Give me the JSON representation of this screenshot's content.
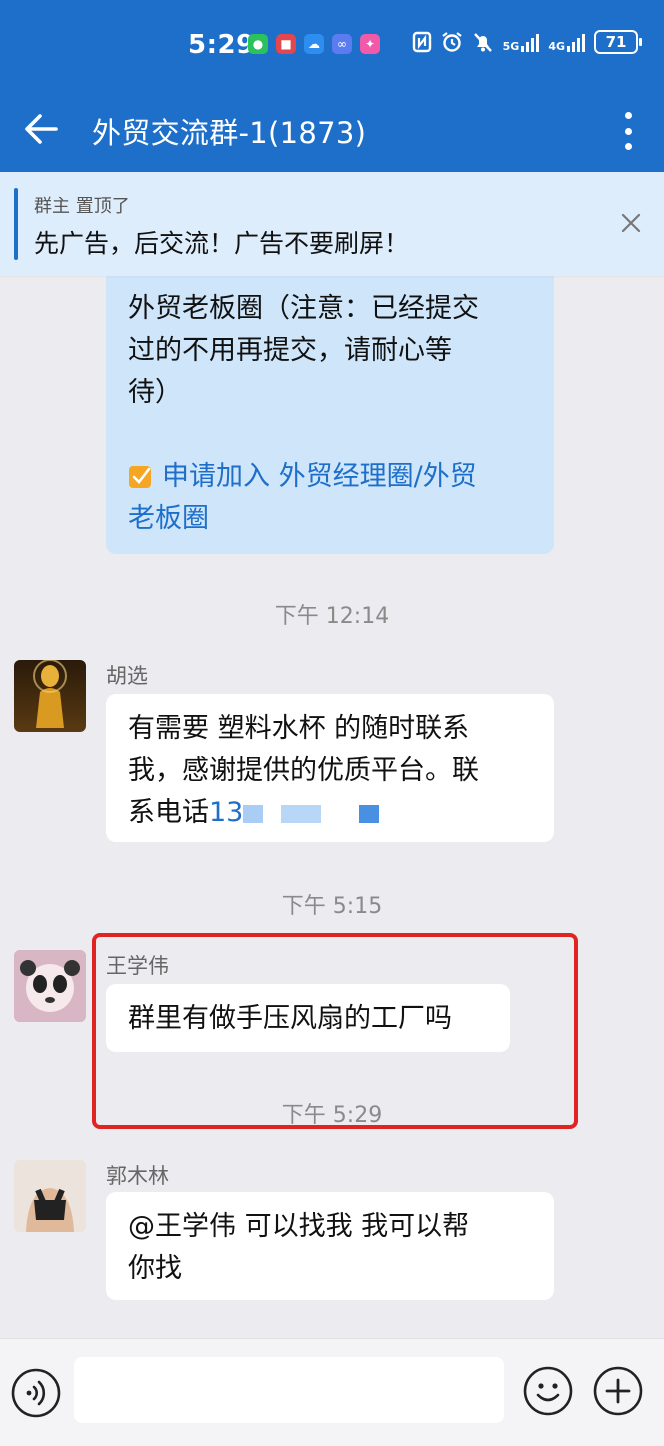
{
  "status_bar": {
    "time": "5:29",
    "net1": "5G",
    "net2": "4G",
    "battery": "71"
  },
  "header": {
    "title": "外贸交流群-1(1873)"
  },
  "pinned": {
    "meta": "群主 置顶了",
    "text": "先广告，后交流！广告不要刷屏！"
  },
  "messages": {
    "announcement": {
      "lines": [
        "外贸老板圈（注意：已经提交",
        "过的不用再提交，请耐心等",
        "待）"
      ],
      "link_lines": [
        "申请加入 外贸经理圈/外贸",
        "老板圈"
      ]
    },
    "ts1": "下午 12:14",
    "m1": {
      "sender": "胡选",
      "lines": [
        "有需要  塑料水杯  的随时联系",
        "我，感谢提供的优质平台。联"
      ],
      "line3_prefix": "系电话",
      "phone_partial": "13"
    },
    "ts2": "下午 5:15",
    "m2": {
      "sender": "王学伟",
      "text": "群里有做手压风扇的工厂吗"
    },
    "ts3": "下午 5:29",
    "m3": {
      "sender": "郭木林",
      "lines": [
        "@王学伟  可以找我 我可以帮",
        "你找"
      ]
    }
  },
  "input": {
    "placeholder": ""
  },
  "colors": {
    "header": "#1e6fc9",
    "pin_bg": "#deedfb",
    "chat_bg": "#ececf0",
    "highlight": "#e02424"
  }
}
